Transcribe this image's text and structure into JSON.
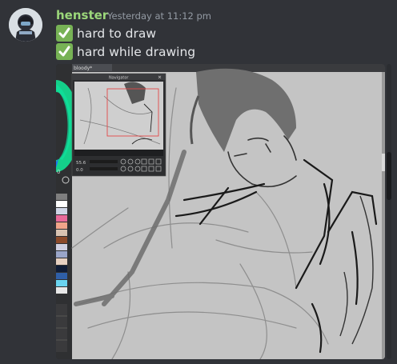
{
  "message": {
    "author": "henster",
    "timestamp": "Yesterday at 11:12 pm",
    "lines": [
      {
        "emoji": "check-mark-icon",
        "text": "hard to draw"
      },
      {
        "emoji": "check-mark-icon",
        "text": "hard while drawing"
      }
    ]
  },
  "attachment": {
    "tab_title": "bloody*",
    "navigator_title": "Navigator",
    "zoom_value": "55.6",
    "rotation_value": "0.0"
  },
  "colors": {
    "author": "#9bd77a",
    "background": "#313338",
    "check": "#77b255",
    "canvas": "#c3c3c3"
  }
}
